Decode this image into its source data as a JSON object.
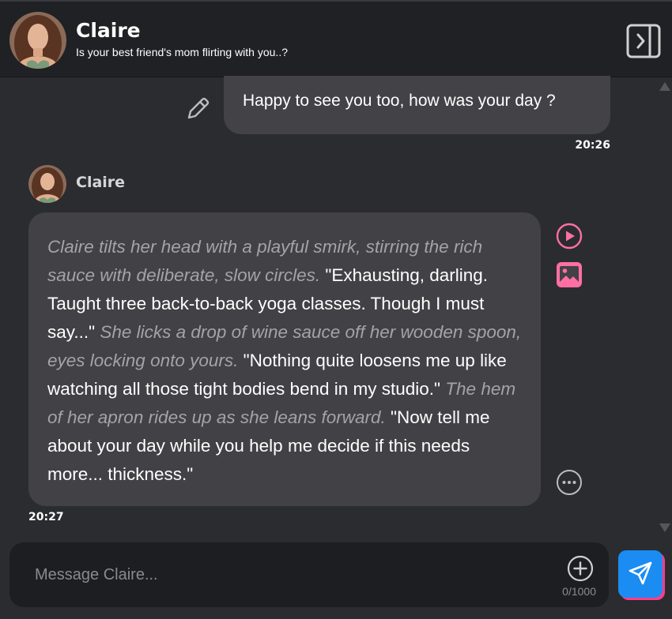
{
  "header": {
    "character_name": "Claire",
    "subtitle": "Is your best friend's mom flirting with you..?",
    "avatar_alt": "Claire avatar"
  },
  "messages": {
    "user": {
      "text": "Happy to see you too, how was your day ?",
      "time": "20:26"
    },
    "bot": {
      "sender": "Claire",
      "time": "20:27",
      "segments": [
        {
          "type": "action",
          "text": "Claire tilts her head with a playful smirk, stirring the rich sauce with deliberate, slow circles."
        },
        {
          "type": "speech",
          "text": " \"Exhausting, darling. Taught three back-to-back yoga classes. Though I must say...\" "
        },
        {
          "type": "action",
          "text": "She licks a drop of wine sauce off her wooden spoon, eyes locking onto yours."
        },
        {
          "type": "speech",
          "text": " \"Nothing quite loosens me up like watching all those tight bodies bend in my studio.\" "
        },
        {
          "type": "action",
          "text": "The hem of her apron rides up as she leans forward."
        },
        {
          "type": "speech",
          "text": " \"Now tell me about your day while you help me decide if this needs more... thickness.\""
        }
      ]
    }
  },
  "composer": {
    "placeholder": "Message Claire...",
    "value": "",
    "counter": "0/1000"
  },
  "icons": {
    "panel": "sidebar-toggle-icon",
    "edit": "pencil-icon",
    "play": "play-circle-icon",
    "image": "image-icon",
    "more": "more-horizontal-icon",
    "add": "plus-circle-icon",
    "send": "send-icon"
  },
  "colors": {
    "background": "#2b2c30",
    "header_bg": "#202124",
    "bubble_bg": "#424145",
    "action_text": "#a5a3a8",
    "accent_pink": "#ff6fa3",
    "send_blue": "#1b8cf2"
  }
}
